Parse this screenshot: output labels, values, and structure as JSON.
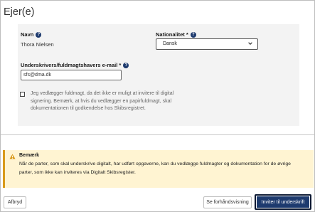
{
  "section": {
    "title": "Ejer(e)"
  },
  "form": {
    "name_label": "Navn",
    "name_value": "Thora Nielsen",
    "nationality_label": "Nationalitet *",
    "nationality_value": "Dansk",
    "email_label": "Underskrivers/fuldmagtshavers e-mail *",
    "email_value": "sfs@dma.dk",
    "checkbox_checked": false,
    "checkbox_text": "Jeg vedlægger fuldmagt, da det ikke er muligt at invitere til digital signering. Bemærk, at hvis du vedlægger en papirfuldmagt, skal dokumentationen til godkendelse hos Skibsregistret."
  },
  "notice": {
    "title": "Bemærk",
    "body": "Når de parter, som skal underskrive digitalt, har udført opgaverne, kan du vedlægge fuldmagter og dokumentation for de øvrige parter, som ikke kan inviteres via Digitalt Skibsregister."
  },
  "footer": {
    "cancel_label": "Afbryd",
    "preview_label": "Se forhåndsvisning",
    "invite_label": "Inviter til underskrift"
  },
  "colors": {
    "primary": "#1d3a6e",
    "notice_bg": "#fff4d2",
    "notice_accent": "#d99a1b",
    "card_bg": "#f3f3f3"
  },
  "icons": [
    "help-icon",
    "chevron-down-icon",
    "warning-icon"
  ]
}
